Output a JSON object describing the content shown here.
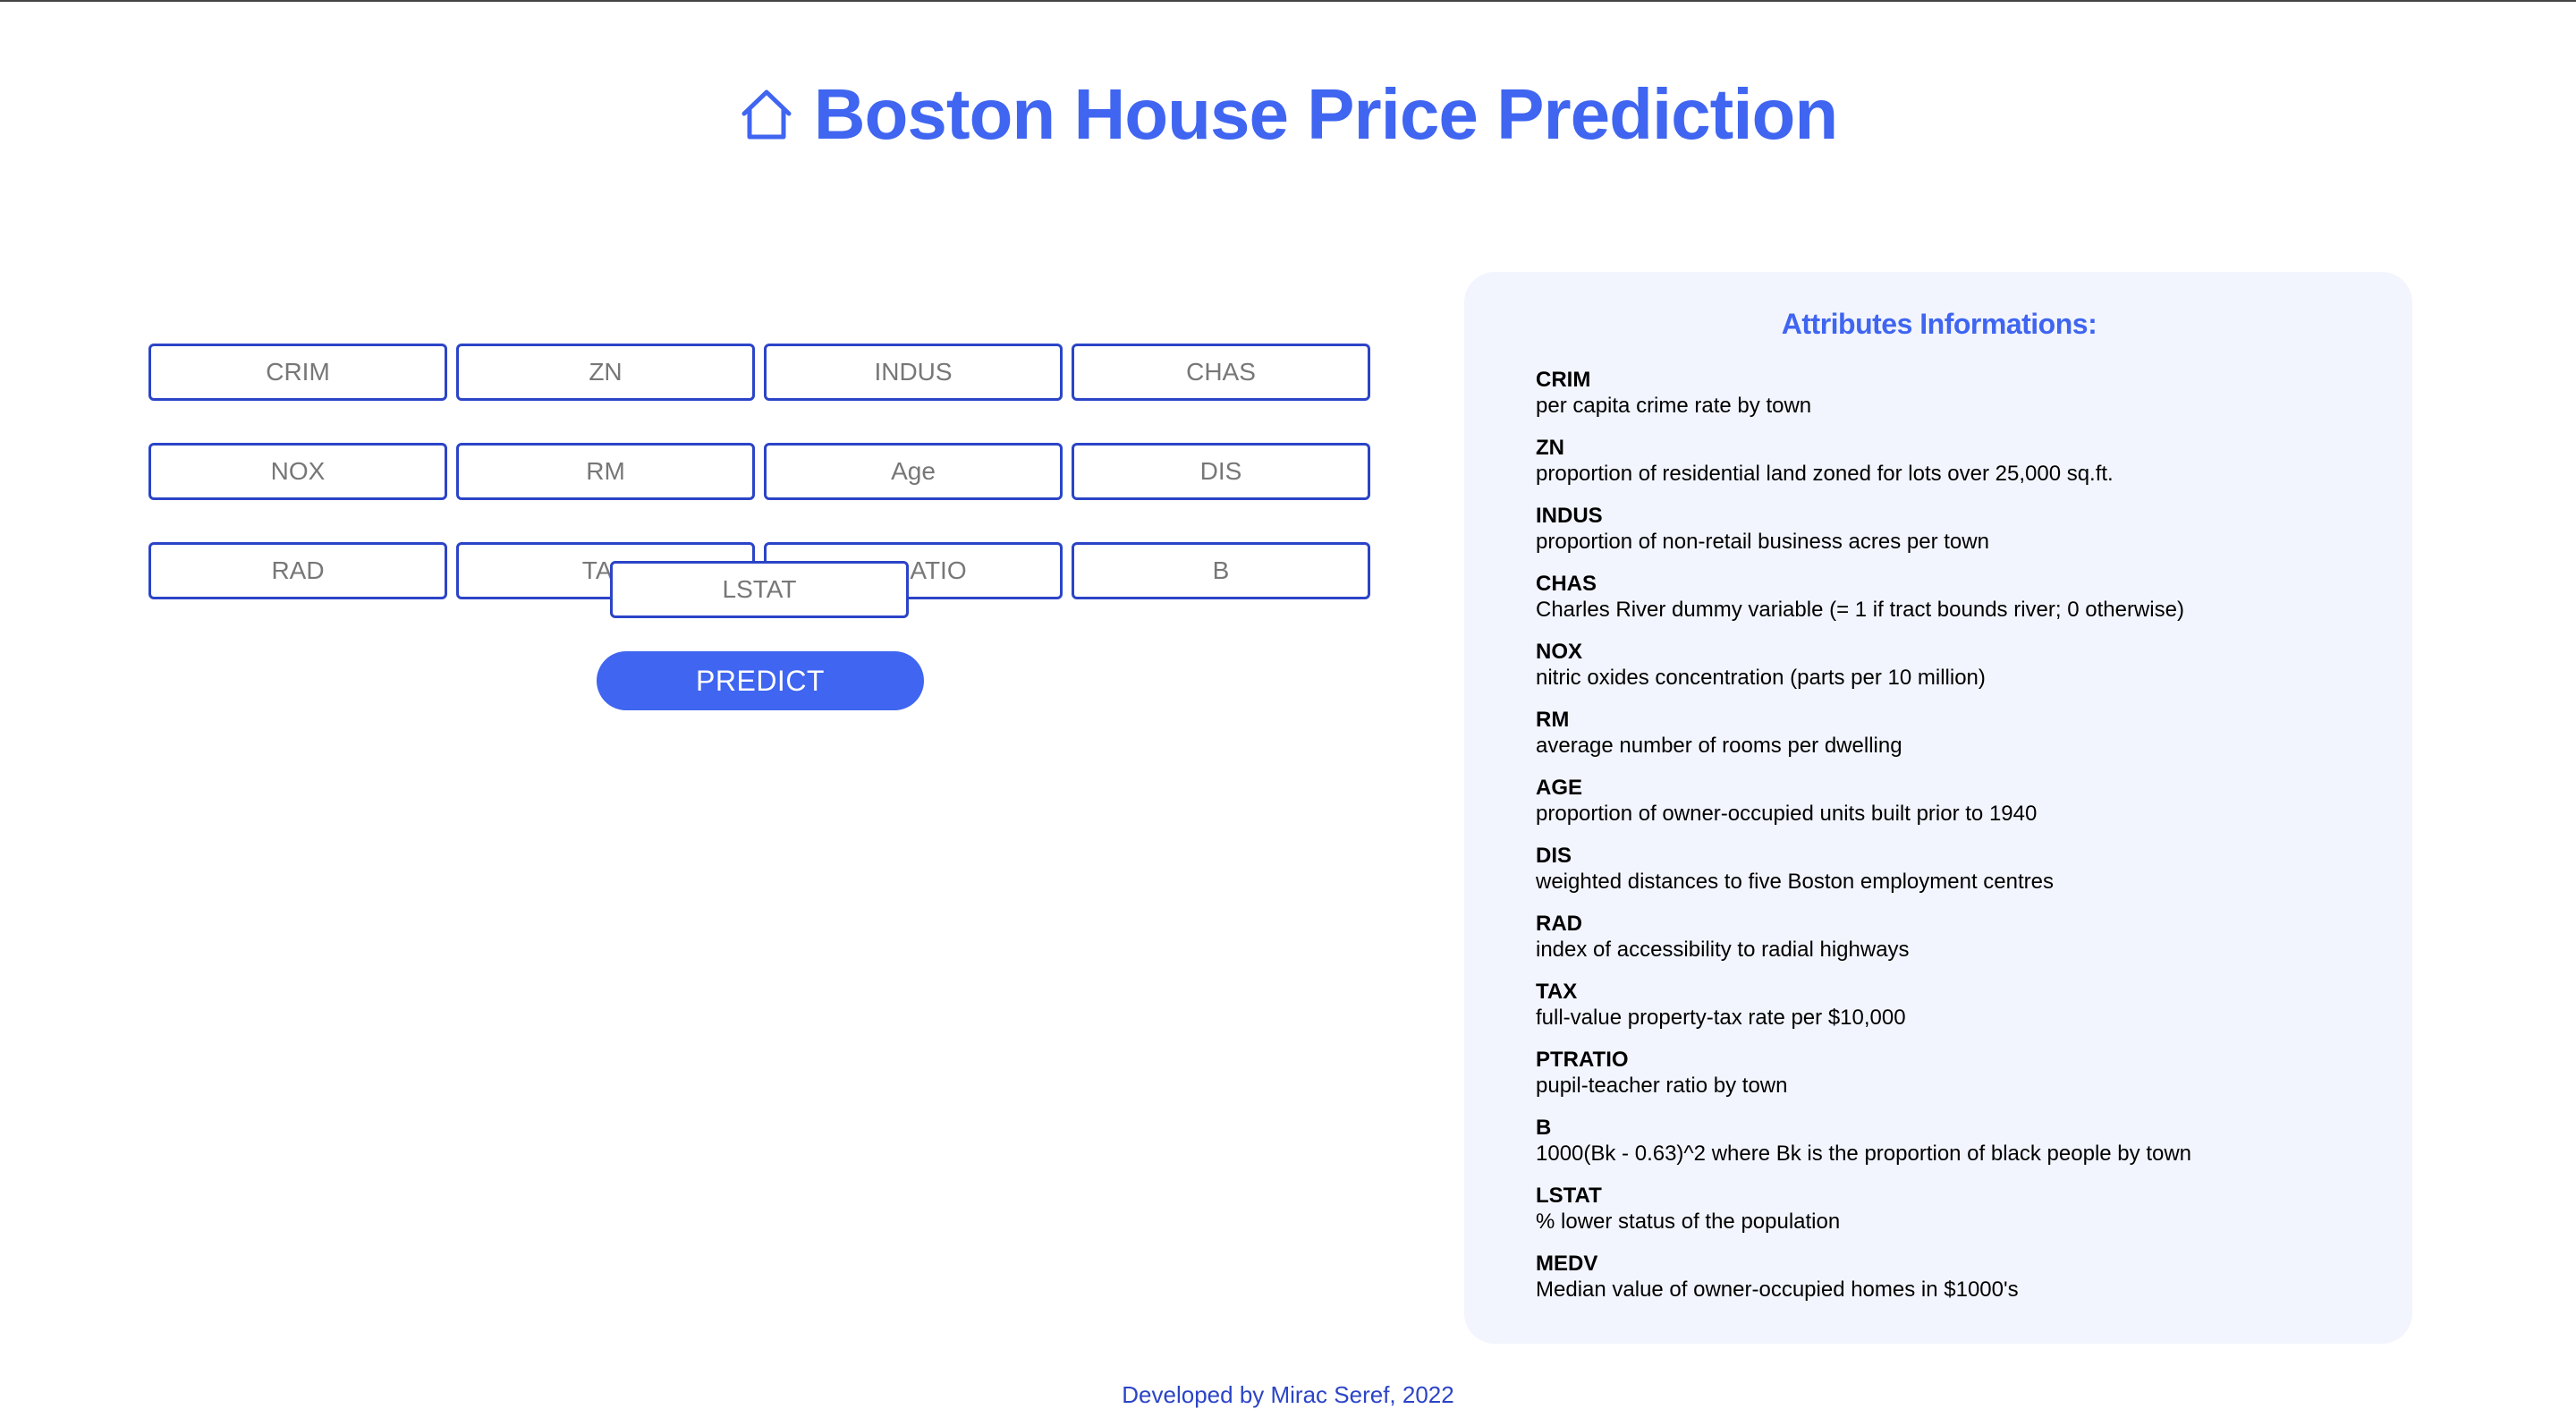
{
  "header": {
    "title": "Boston House Price Prediction",
    "icon": "home-icon",
    "accent_color": "#3f65f1"
  },
  "form": {
    "fields": [
      {
        "name": "crim",
        "placeholder": "CRIM"
      },
      {
        "name": "zn",
        "placeholder": "ZN"
      },
      {
        "name": "indus",
        "placeholder": "INDUS"
      },
      {
        "name": "chas",
        "placeholder": "CHAS"
      },
      {
        "name": "nox",
        "placeholder": "NOX"
      },
      {
        "name": "rm",
        "placeholder": "RM"
      },
      {
        "name": "age",
        "placeholder": "Age"
      },
      {
        "name": "dis",
        "placeholder": "DIS"
      },
      {
        "name": "rad",
        "placeholder": "RAD"
      },
      {
        "name": "tax",
        "placeholder": "TAX"
      },
      {
        "name": "ptratio",
        "placeholder": "PTRATIO"
      },
      {
        "name": "b",
        "placeholder": "B"
      },
      {
        "name": "lstat",
        "placeholder": "LSTAT"
      }
    ],
    "predict_label": "PREDICT"
  },
  "info": {
    "title": "Attributes Informations:",
    "attributes": [
      {
        "name": "CRIM",
        "desc": "per capita crime rate by town"
      },
      {
        "name": "ZN",
        "desc": "proportion of residential land zoned for lots over 25,000 sq.ft."
      },
      {
        "name": "INDUS",
        "desc": "proportion of non-retail business acres per town"
      },
      {
        "name": "CHAS",
        "desc": "Charles River dummy variable (= 1 if tract bounds river; 0 otherwise)"
      },
      {
        "name": "NOX",
        "desc": "nitric oxides concentration (parts per 10 million)"
      },
      {
        "name": "RM",
        "desc": "average number of rooms per dwelling"
      },
      {
        "name": "AGE",
        "desc": "proportion of owner-occupied units built prior to 1940"
      },
      {
        "name": "DIS",
        "desc": "weighted distances to five Boston employment centres"
      },
      {
        "name": "RAD",
        "desc": "index of accessibility to radial highways"
      },
      {
        "name": "TAX",
        "desc": "full-value property-tax rate per $10,000"
      },
      {
        "name": "PTRATIO",
        "desc": "pupil-teacher ratio by town"
      },
      {
        "name": "B",
        "desc": "1000(Bk - 0.63)^2 where Bk is the proportion of black people by town"
      },
      {
        "name": "LSTAT",
        "desc": "% lower status of the population"
      },
      {
        "name": "MEDV",
        "desc": "Median value of owner-occupied homes in $1000's"
      }
    ]
  },
  "footer": {
    "text": "Developed by Mirac Seref, 2022"
  }
}
